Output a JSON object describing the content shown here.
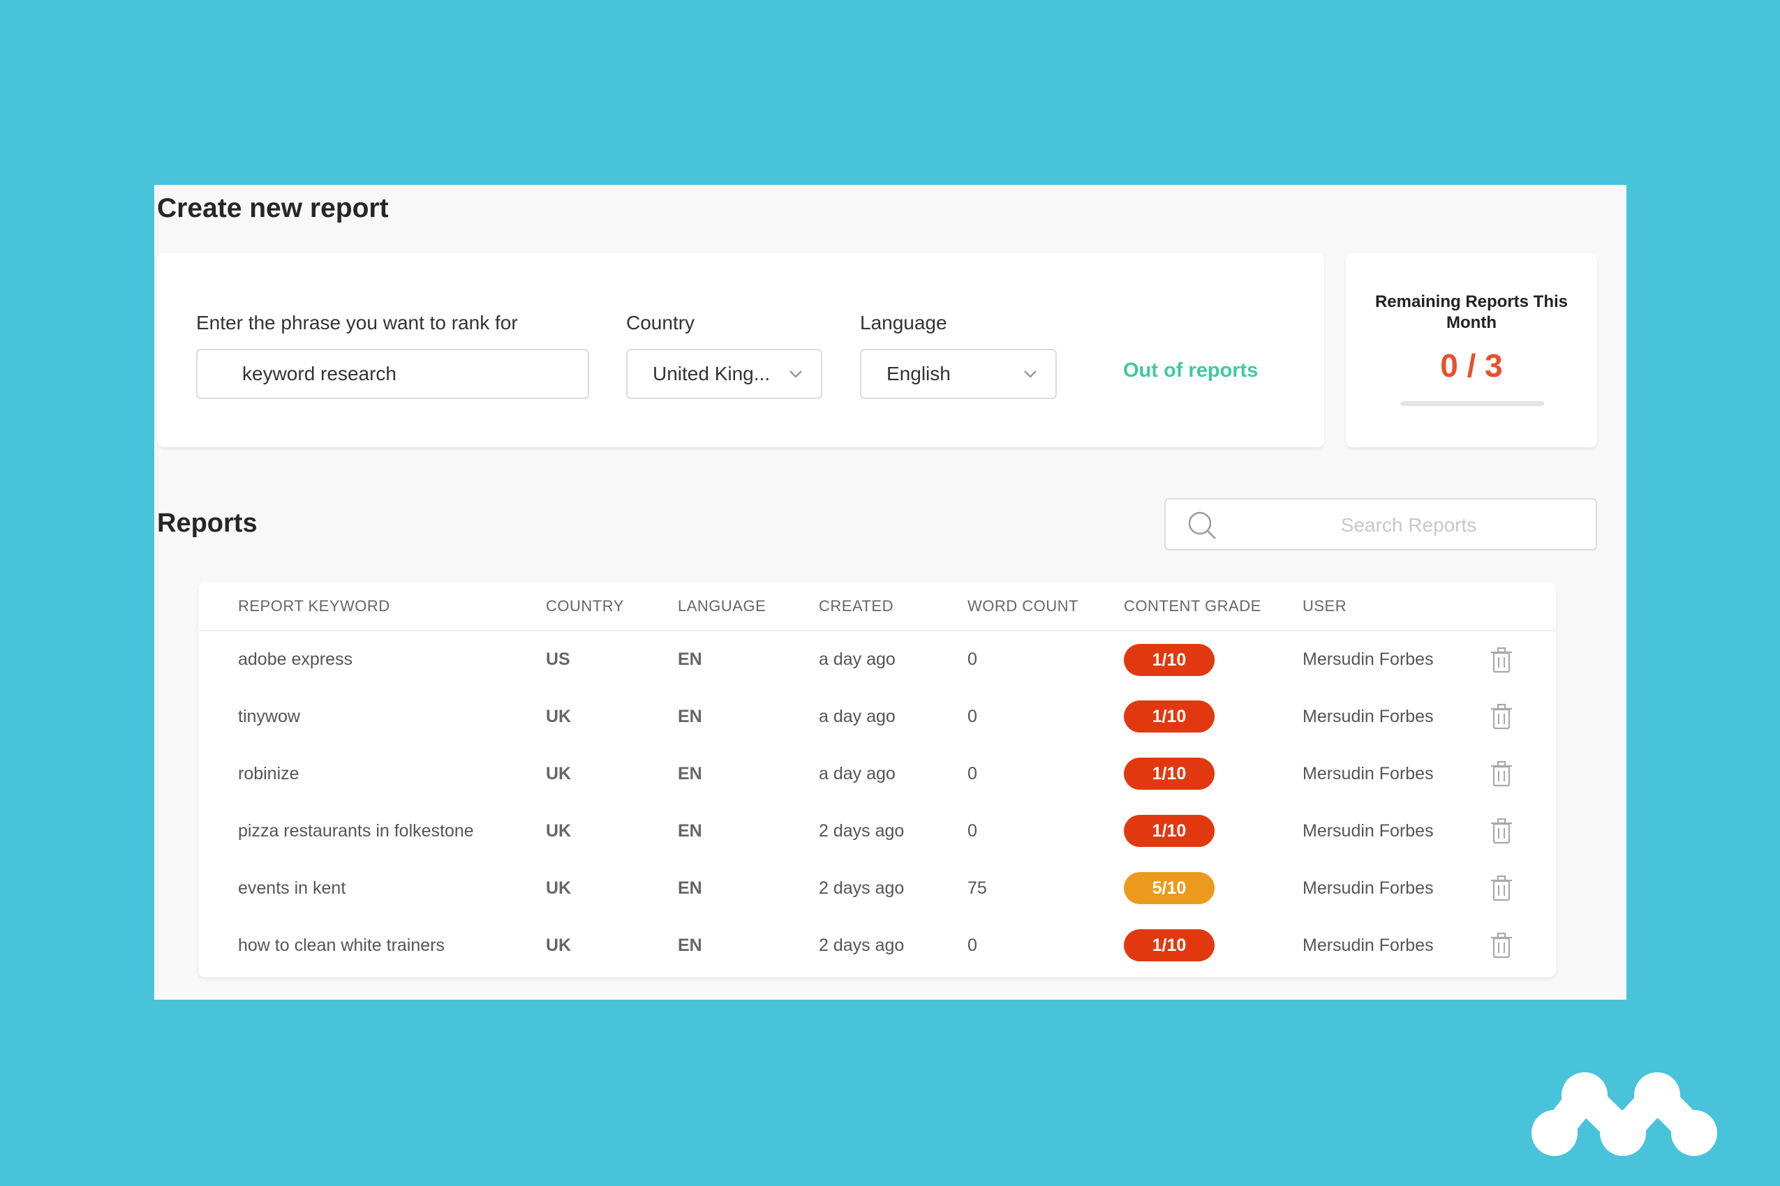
{
  "create": {
    "title": "Create new report",
    "phrase_label": "Enter the phrase you want to rank for",
    "phrase_value": "keyword research",
    "country_label": "Country",
    "country_value": "United King...",
    "language_label": "Language",
    "language_value": "English",
    "out_of_reports": "Out of reports"
  },
  "remaining": {
    "title": "Remaining Reports This Month",
    "value": "0 / 3",
    "used": 0,
    "total": 3
  },
  "reports": {
    "title": "Reports",
    "search_placeholder": "Search Reports",
    "columns": [
      "REPORT KEYWORD",
      "COUNTRY",
      "LANGUAGE",
      "CREATED",
      "WORD COUNT",
      "CONTENT GRADE",
      "USER"
    ],
    "rows": [
      {
        "keyword": "adobe express",
        "country": "US",
        "language": "EN",
        "created": "a day ago",
        "word_count": "0",
        "grade": "1/10",
        "grade_color": "#e2380f",
        "user": "Mersudin Forbes"
      },
      {
        "keyword": "tinywow",
        "country": "UK",
        "language": "EN",
        "created": "a day ago",
        "word_count": "0",
        "grade": "1/10",
        "grade_color": "#e2380f",
        "user": "Mersudin Forbes"
      },
      {
        "keyword": "robinize",
        "country": "UK",
        "language": "EN",
        "created": "a day ago",
        "word_count": "0",
        "grade": "1/10",
        "grade_color": "#e2380f",
        "user": "Mersudin Forbes"
      },
      {
        "keyword": "pizza restaurants in folkestone",
        "country": "UK",
        "language": "EN",
        "created": "2 days ago",
        "word_count": "0",
        "grade": "1/10",
        "grade_color": "#e2380f",
        "user": "Mersudin Forbes"
      },
      {
        "keyword": "events in kent",
        "country": "UK",
        "language": "EN",
        "created": "2 days ago",
        "word_count": "75",
        "grade": "5/10",
        "grade_color": "#eb9a1e",
        "user": "Mersudin Forbes"
      },
      {
        "keyword": "how to clean white trainers",
        "country": "UK",
        "language": "EN",
        "created": "2 days ago",
        "word_count": "0",
        "grade": "1/10",
        "grade_color": "#e2380f",
        "user": "Mersudin Forbes"
      }
    ]
  },
  "icons": {
    "search": "search-icon",
    "chevron": "chevron-down-icon",
    "trash": "trash-icon",
    "logo": "logo-icon"
  },
  "colors": {
    "background": "#48c3d9",
    "accent_green": "#3fc9a0",
    "counter_red": "#e8502a",
    "grade_low": "#e2380f",
    "grade_mid": "#eb9a1e"
  }
}
